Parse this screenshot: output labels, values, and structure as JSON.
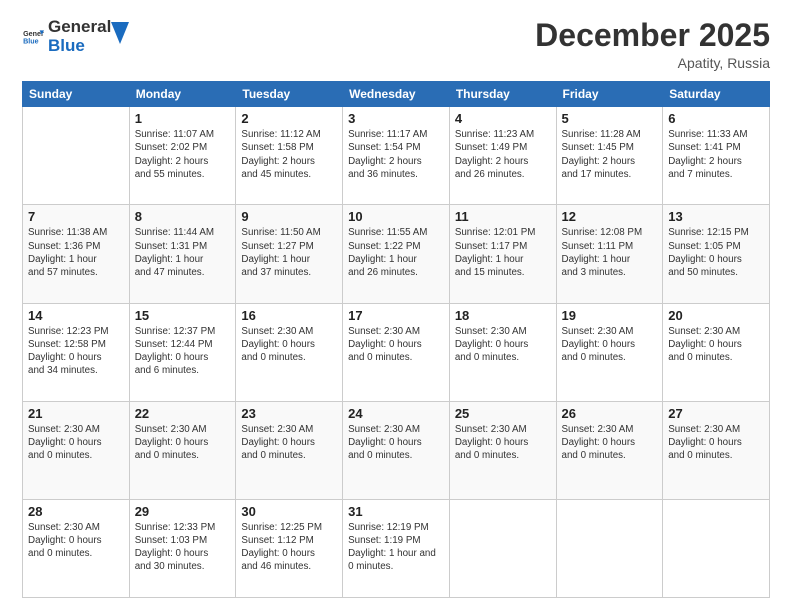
{
  "header": {
    "logo_general": "General",
    "logo_blue": "Blue",
    "month_title": "December 2025",
    "subtitle": "Apatity, Russia"
  },
  "weekdays": [
    "Sunday",
    "Monday",
    "Tuesday",
    "Wednesday",
    "Thursday",
    "Friday",
    "Saturday"
  ],
  "rows": [
    [
      {
        "num": "",
        "info": ""
      },
      {
        "num": "1",
        "info": "Sunrise: 11:07 AM\nSunset: 2:02 PM\nDaylight: 2 hours\nand 55 minutes."
      },
      {
        "num": "2",
        "info": "Sunrise: 11:12 AM\nSunset: 1:58 PM\nDaylight: 2 hours\nand 45 minutes."
      },
      {
        "num": "3",
        "info": "Sunrise: 11:17 AM\nSunset: 1:54 PM\nDaylight: 2 hours\nand 36 minutes."
      },
      {
        "num": "4",
        "info": "Sunrise: 11:23 AM\nSunset: 1:49 PM\nDaylight: 2 hours\nand 26 minutes."
      },
      {
        "num": "5",
        "info": "Sunrise: 11:28 AM\nSunset: 1:45 PM\nDaylight: 2 hours\nand 17 minutes."
      },
      {
        "num": "6",
        "info": "Sunrise: 11:33 AM\nSunset: 1:41 PM\nDaylight: 2 hours\nand 7 minutes."
      }
    ],
    [
      {
        "num": "7",
        "info": "Sunrise: 11:38 AM\nSunset: 1:36 PM\nDaylight: 1 hour\nand 57 minutes."
      },
      {
        "num": "8",
        "info": "Sunrise: 11:44 AM\nSunset: 1:31 PM\nDaylight: 1 hour\nand 47 minutes."
      },
      {
        "num": "9",
        "info": "Sunrise: 11:50 AM\nSunset: 1:27 PM\nDaylight: 1 hour\nand 37 minutes."
      },
      {
        "num": "10",
        "info": "Sunrise: 11:55 AM\nSunset: 1:22 PM\nDaylight: 1 hour\nand 26 minutes."
      },
      {
        "num": "11",
        "info": "Sunrise: 12:01 PM\nSunset: 1:17 PM\nDaylight: 1 hour\nand 15 minutes."
      },
      {
        "num": "12",
        "info": "Sunrise: 12:08 PM\nSunset: 1:11 PM\nDaylight: 1 hour\nand 3 minutes."
      },
      {
        "num": "13",
        "info": "Sunrise: 12:15 PM\nSunset: 1:05 PM\nDaylight: 0 hours\nand 50 minutes."
      }
    ],
    [
      {
        "num": "14",
        "info": "Sunrise: 12:23 PM\nSunset: 12:58 PM\nDaylight: 0 hours\nand 34 minutes."
      },
      {
        "num": "15",
        "info": "Sunrise: 12:37 PM\nSunset: 12:44 PM\nDaylight: 0 hours\nand 6 minutes."
      },
      {
        "num": "16",
        "info": "Sunset: 2:30 AM\nDaylight: 0 hours\nand 0 minutes."
      },
      {
        "num": "17",
        "info": "Sunset: 2:30 AM\nDaylight: 0 hours\nand 0 minutes."
      },
      {
        "num": "18",
        "info": "Sunset: 2:30 AM\nDaylight: 0 hours\nand 0 minutes."
      },
      {
        "num": "19",
        "info": "Sunset: 2:30 AM\nDaylight: 0 hours\nand 0 minutes."
      },
      {
        "num": "20",
        "info": "Sunset: 2:30 AM\nDaylight: 0 hours\nand 0 minutes."
      }
    ],
    [
      {
        "num": "21",
        "info": "Sunset: 2:30 AM\nDaylight: 0 hours\nand 0 minutes."
      },
      {
        "num": "22",
        "info": "Sunset: 2:30 AM\nDaylight: 0 hours\nand 0 minutes."
      },
      {
        "num": "23",
        "info": "Sunset: 2:30 AM\nDaylight: 0 hours\nand 0 minutes."
      },
      {
        "num": "24",
        "info": "Sunset: 2:30 AM\nDaylight: 0 hours\nand 0 minutes."
      },
      {
        "num": "25",
        "info": "Sunset: 2:30 AM\nDaylight: 0 hours\nand 0 minutes."
      },
      {
        "num": "26",
        "info": "Sunset: 2:30 AM\nDaylight: 0 hours\nand 0 minutes."
      },
      {
        "num": "27",
        "info": "Sunset: 2:30 AM\nDaylight: 0 hours\nand 0 minutes."
      }
    ],
    [
      {
        "num": "28",
        "info": "Sunset: 2:30 AM\nDaylight: 0 hours\nand 0 minutes."
      },
      {
        "num": "29",
        "info": "Sunrise: 12:33 PM\nSunset: 1:03 PM\nDaylight: 0 hours\nand 30 minutes."
      },
      {
        "num": "30",
        "info": "Sunrise: 12:25 PM\nSunset: 1:12 PM\nDaylight: 0 hours\nand 46 minutes."
      },
      {
        "num": "31",
        "info": "Sunrise: 12:19 PM\nSunset: 1:19 PM\nDaylight: 1 hour and\n0 minutes."
      },
      {
        "num": "",
        "info": ""
      },
      {
        "num": "",
        "info": ""
      },
      {
        "num": "",
        "info": ""
      }
    ]
  ]
}
